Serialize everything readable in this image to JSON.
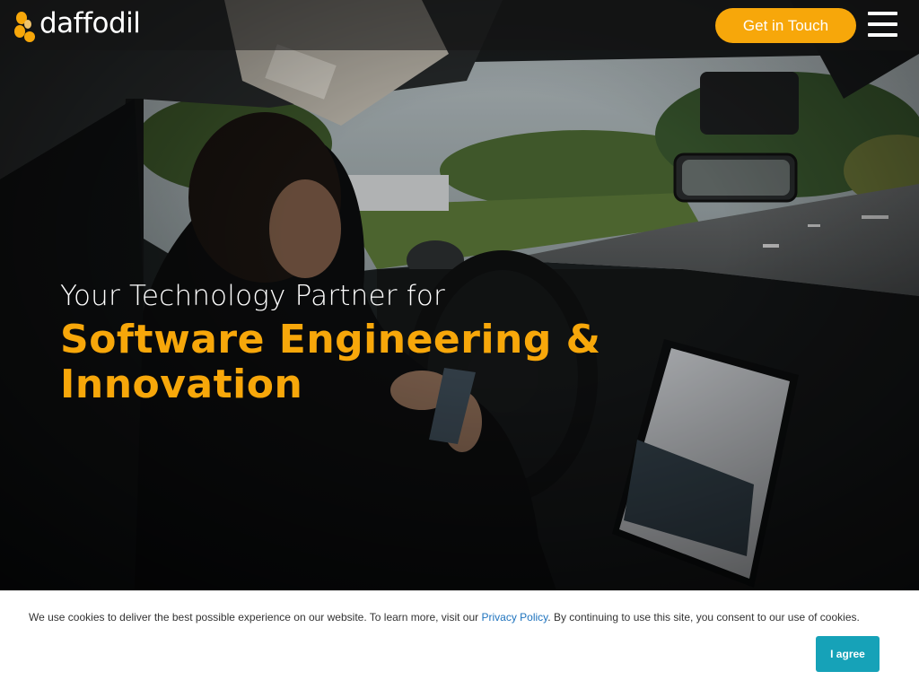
{
  "brand": {
    "name": "daffodil",
    "logo_icon": "daffodil-flower-icon",
    "accent_color": "#f7a70a"
  },
  "nav": {
    "cta_label": "Get in Touch",
    "menu_icon": "hamburger-menu-icon"
  },
  "hero": {
    "tagline": "Your Technology Partner for",
    "headline_line1": "Software Engineering &",
    "headline_line2": "Innovation",
    "background_image": "person-in-car-using-phone-photo"
  },
  "cookie_banner": {
    "message_before": "We use cookies to deliver the best possible experience on our website. To learn more, visit our ",
    "privacy_link": "Privacy Policy",
    "message_after": ". By continuing to use this site, you consent to our use of cookies.",
    "agree_label": "I agree",
    "button_color": "#16a2b8"
  }
}
